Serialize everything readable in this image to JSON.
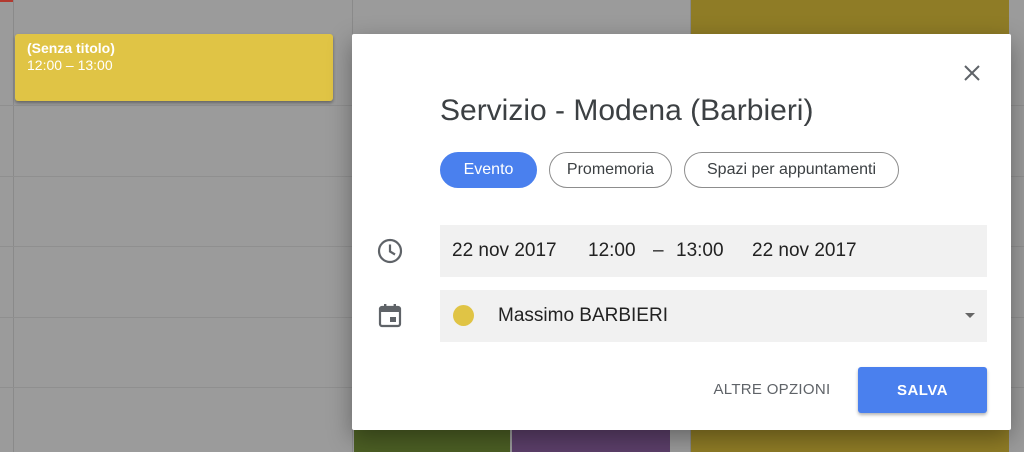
{
  "calendar_event": {
    "title": "(Senza titolo)",
    "time": "12:00 – 13:00"
  },
  "dialog": {
    "title": "Servizio - Modena (Barbieri)",
    "close_icon": "close-icon",
    "types": [
      {
        "label": "Evento",
        "active": true
      },
      {
        "label": "Promemoria",
        "active": false
      },
      {
        "label": "Spazi per appuntamenti",
        "active": false
      }
    ],
    "time_row": {
      "icon": "clock-icon",
      "start_date": "22 nov 2017",
      "start_time": "12:00",
      "separator": "–",
      "end_time": "13:00",
      "end_date": "22 nov 2017"
    },
    "calendar_row": {
      "icon": "calendar-icon",
      "calendar_name": "Massimo BARBIERI",
      "color": "#e0c445"
    },
    "more_options_label": "ALTRE OPZIONI",
    "save_label": "SALVA"
  },
  "colors": {
    "accent": "#4a80ee",
    "event_yellow": "#e0c445",
    "event_green": "#4c5f24",
    "event_purple": "#5c3f6a",
    "event_olive": "#8f7c26"
  }
}
